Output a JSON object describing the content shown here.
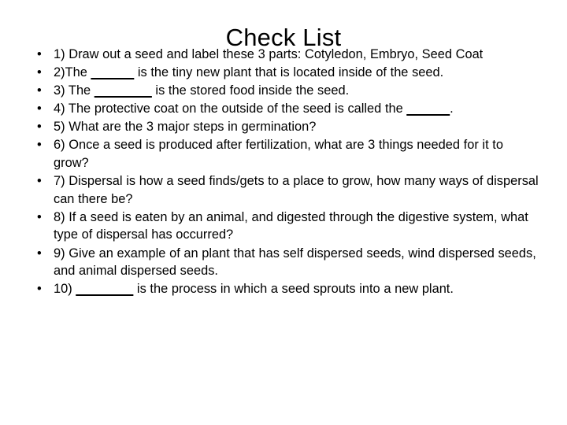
{
  "slide": {
    "title": "Check List",
    "bullet_glyph": "•",
    "text_color": "#000000",
    "background_color": "#ffffff",
    "items": [
      {
        "number": "1)",
        "segments": [
          {
            "type": "text",
            "value": "1) Draw out a seed and label these 3 parts: Cotyledon, Embryo, Seed Coat"
          }
        ],
        "plain": "1) Draw out a seed and label these 3 parts: Cotyledon, Embryo, Seed Coat"
      },
      {
        "number": "2)",
        "segments": [
          {
            "type": "text",
            "value": "2)The "
          },
          {
            "type": "blank",
            "value": "______"
          },
          {
            "type": "text",
            "value": " is the tiny new plant that is located inside of the seed."
          }
        ],
        "plain": "2)The ______ is the tiny new plant that is located inside of the seed."
      },
      {
        "number": "3)",
        "segments": [
          {
            "type": "text",
            "value": "3) The "
          },
          {
            "type": "blank",
            "value": "________"
          },
          {
            "type": "text",
            "value": " is the stored food inside the seed."
          }
        ],
        "plain": "3) The ________ is the stored food inside the seed."
      },
      {
        "number": "4)",
        "segments": [
          {
            "type": "text",
            "value": "4) The protective coat on the outside of the seed is called the "
          },
          {
            "type": "blank",
            "value": "______"
          },
          {
            "type": "text",
            "value": "."
          }
        ],
        "plain": "4) The protective coat on the outside of the seed is called the ______."
      },
      {
        "number": "5)",
        "segments": [
          {
            "type": "text",
            "value": "5) What are the 3 major steps in germination?"
          }
        ],
        "plain": "5) What are the 3 major steps in germination?"
      },
      {
        "number": "6)",
        "segments": [
          {
            "type": "text",
            "value": "6) Once a seed is produced after fertilization, what are 3 things needed for it to grow?"
          }
        ],
        "plain": "6) Once a seed is produced after fertilization, what are 3 things needed for it to grow?"
      },
      {
        "number": "7)",
        "segments": [
          {
            "type": "text",
            "value": "7) Dispersal is how a seed finds/gets to a place to grow, how many ways of dispersal can there be?"
          }
        ],
        "plain": "7) Dispersal is how a seed finds/gets to a place to grow, how many ways of dispersal can there be?"
      },
      {
        "number": "8)",
        "segments": [
          {
            "type": "text",
            "value": "8) If a seed is eaten by an animal, and digested through the digestive system, what type of dispersal has occurred?"
          }
        ],
        "plain": "8) If a seed is eaten by an animal, and digested through the digestive system, what type of dispersal has occurred?"
      },
      {
        "number": "9)",
        "segments": [
          {
            "type": "text",
            "value": "9) Give an example of an plant that has self dispersed seeds, wind dispersed seeds, and animal dispersed seeds."
          }
        ],
        "plain": "9) Give an example of an plant that has self dispersed seeds, wind dispersed seeds, and animal dispersed seeds."
      },
      {
        "number": "10)",
        "segments": [
          {
            "type": "text",
            "value": "10) "
          },
          {
            "type": "blank",
            "value": "________"
          },
          {
            "type": "text",
            "value": " is the process in which a seed sprouts into a new plant."
          }
        ],
        "plain": "10) ________ is the process in which a seed sprouts into a new plant."
      }
    ]
  }
}
